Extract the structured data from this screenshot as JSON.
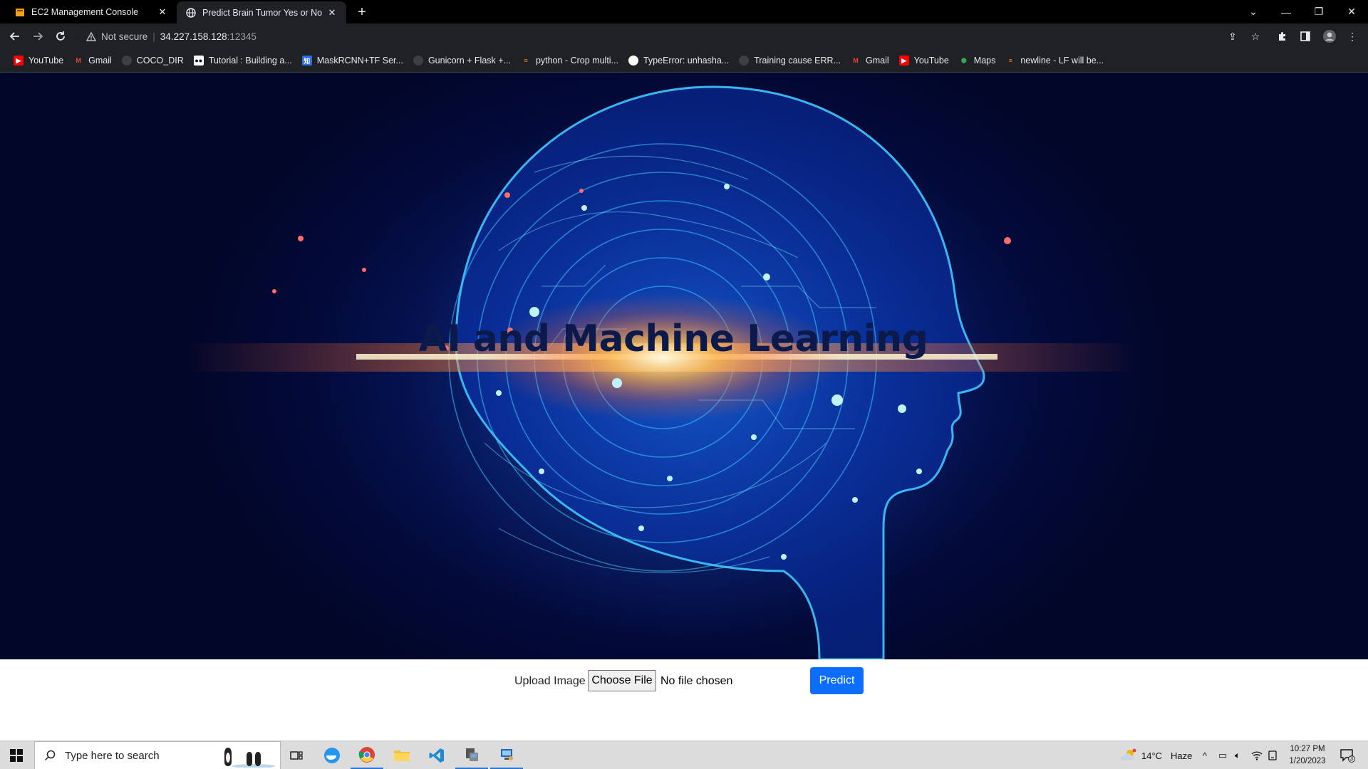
{
  "browser": {
    "tabs": [
      {
        "title": "EC2 Management Console",
        "icon": "aws-icon",
        "active": false
      },
      {
        "title": "Predict Brain Tumor Yes or Not D",
        "icon": "globe-icon",
        "active": true
      }
    ],
    "address": {
      "security_label": "Not secure",
      "host": "34.227.158.128",
      "port": ":12345"
    },
    "bookmarks": [
      {
        "label": "YouTube",
        "icon": "youtube-icon",
        "color": "#ff0000"
      },
      {
        "label": "Gmail",
        "icon": "gmail-icon",
        "color": "#ea4335"
      },
      {
        "label": "COCO_DIR",
        "icon": "github-icon",
        "color": "#444444"
      },
      {
        "label": "Tutorial : Building a...",
        "icon": "medium-icon",
        "color": "#ffffff"
      },
      {
        "label": "MaskRCNN+TF Ser...",
        "icon": "chinese-site-icon",
        "color": "#2b6ee0"
      },
      {
        "label": "Gunicorn + Flask +...",
        "icon": "github-icon",
        "color": "#444444"
      },
      {
        "label": "python - Crop multi...",
        "icon": "stackoverflow-icon",
        "color": "#f48024"
      },
      {
        "label": "TypeError: unhasha...",
        "icon": "github-icon",
        "color": "#ffffff"
      },
      {
        "label": "Training cause ERR...",
        "icon": "github-icon",
        "color": "#444444"
      },
      {
        "label": "Gmail",
        "icon": "gmail-icon",
        "color": "#ea4335"
      },
      {
        "label": "YouTube",
        "icon": "youtube-icon",
        "color": "#ff0000"
      },
      {
        "label": "Maps",
        "icon": "maps-icon",
        "color": "#34a853"
      },
      {
        "label": "newline - LF will be...",
        "icon": "stackoverflow-icon",
        "color": "#f48024"
      }
    ]
  },
  "page": {
    "hero_title": "AI and Machine Learning",
    "upload_label": "Upload Image",
    "file_button": "Choose File",
    "file_status": "No file chosen",
    "predict_button": "Predict",
    "accent_color": "#0d6efd"
  },
  "taskbar": {
    "search_placeholder": "Type here to search",
    "weather": {
      "temp": "14°C",
      "condition": "Haze"
    },
    "time": "10:27 PM",
    "date": "1/20/2023",
    "notifications": "3"
  }
}
